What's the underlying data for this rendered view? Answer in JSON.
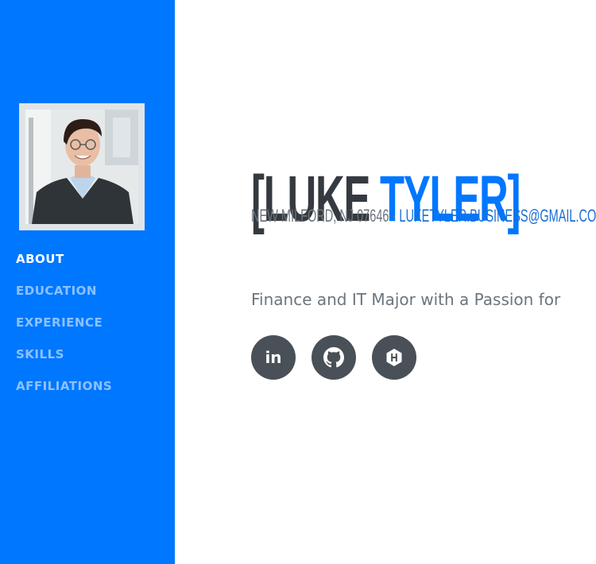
{
  "profile": {
    "first_name": "LUKE",
    "last_name": "TYLER",
    "open_bracket": "[",
    "close_bracket": "]",
    "location": "NEW MILFORD, NJ 07646",
    "separator": " · ",
    "email": "LUKETYLER.BUSINESS@GMAIL.COM",
    "tagline": "Finance and IT Major with a Passion for"
  },
  "nav": {
    "items": [
      {
        "label": "ABOUT",
        "active": true
      },
      {
        "label": "EDUCATION",
        "active": false
      },
      {
        "label": "EXPERIENCE",
        "active": false
      },
      {
        "label": "SKILLS",
        "active": false
      },
      {
        "label": "AFFILIATIONS",
        "active": false
      }
    ]
  },
  "social": {
    "icons": [
      "linkedin-icon",
      "github-icon",
      "hackerrank-icon"
    ],
    "linkedin_glyph": "in"
  },
  "colors": {
    "primary": "#0077ff",
    "heading": "#343a40",
    "muted": "#6c757d",
    "icon_bg": "#495057"
  }
}
